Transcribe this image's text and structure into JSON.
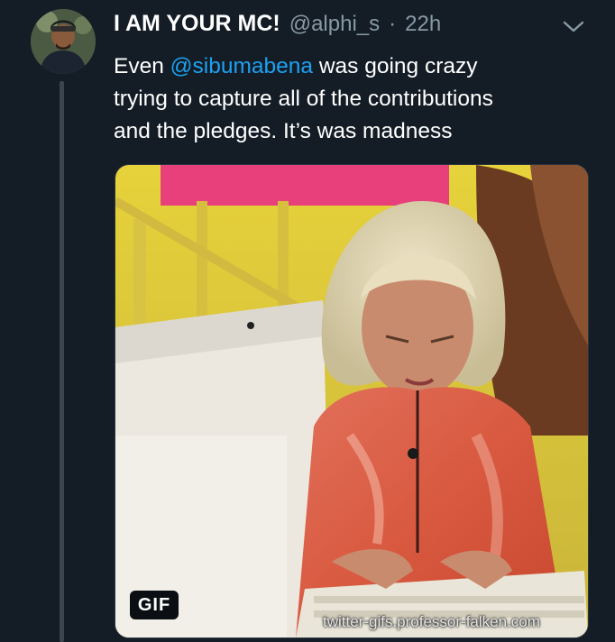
{
  "tweet": {
    "author": {
      "display_name": "I AM YOUR MC!",
      "handle": "@alphi_s",
      "separator": "·",
      "timestamp": "22h"
    },
    "text": {
      "line1_prefix": "Even ",
      "mention": "@sibumabena",
      "line1_suffix": " was going crazy",
      "line2": "trying to capture all of the contributions",
      "line3": "and the pledges. It’s was madness"
    },
    "media": {
      "badge": "GIF",
      "source": "twitter-gifs.professor-falken.com"
    },
    "menu_icon": "chevron-down-icon"
  },
  "colors": {
    "background": "#141d26",
    "text": "#ffffff",
    "secondary": "#8899a6",
    "link": "#1da1f2"
  }
}
